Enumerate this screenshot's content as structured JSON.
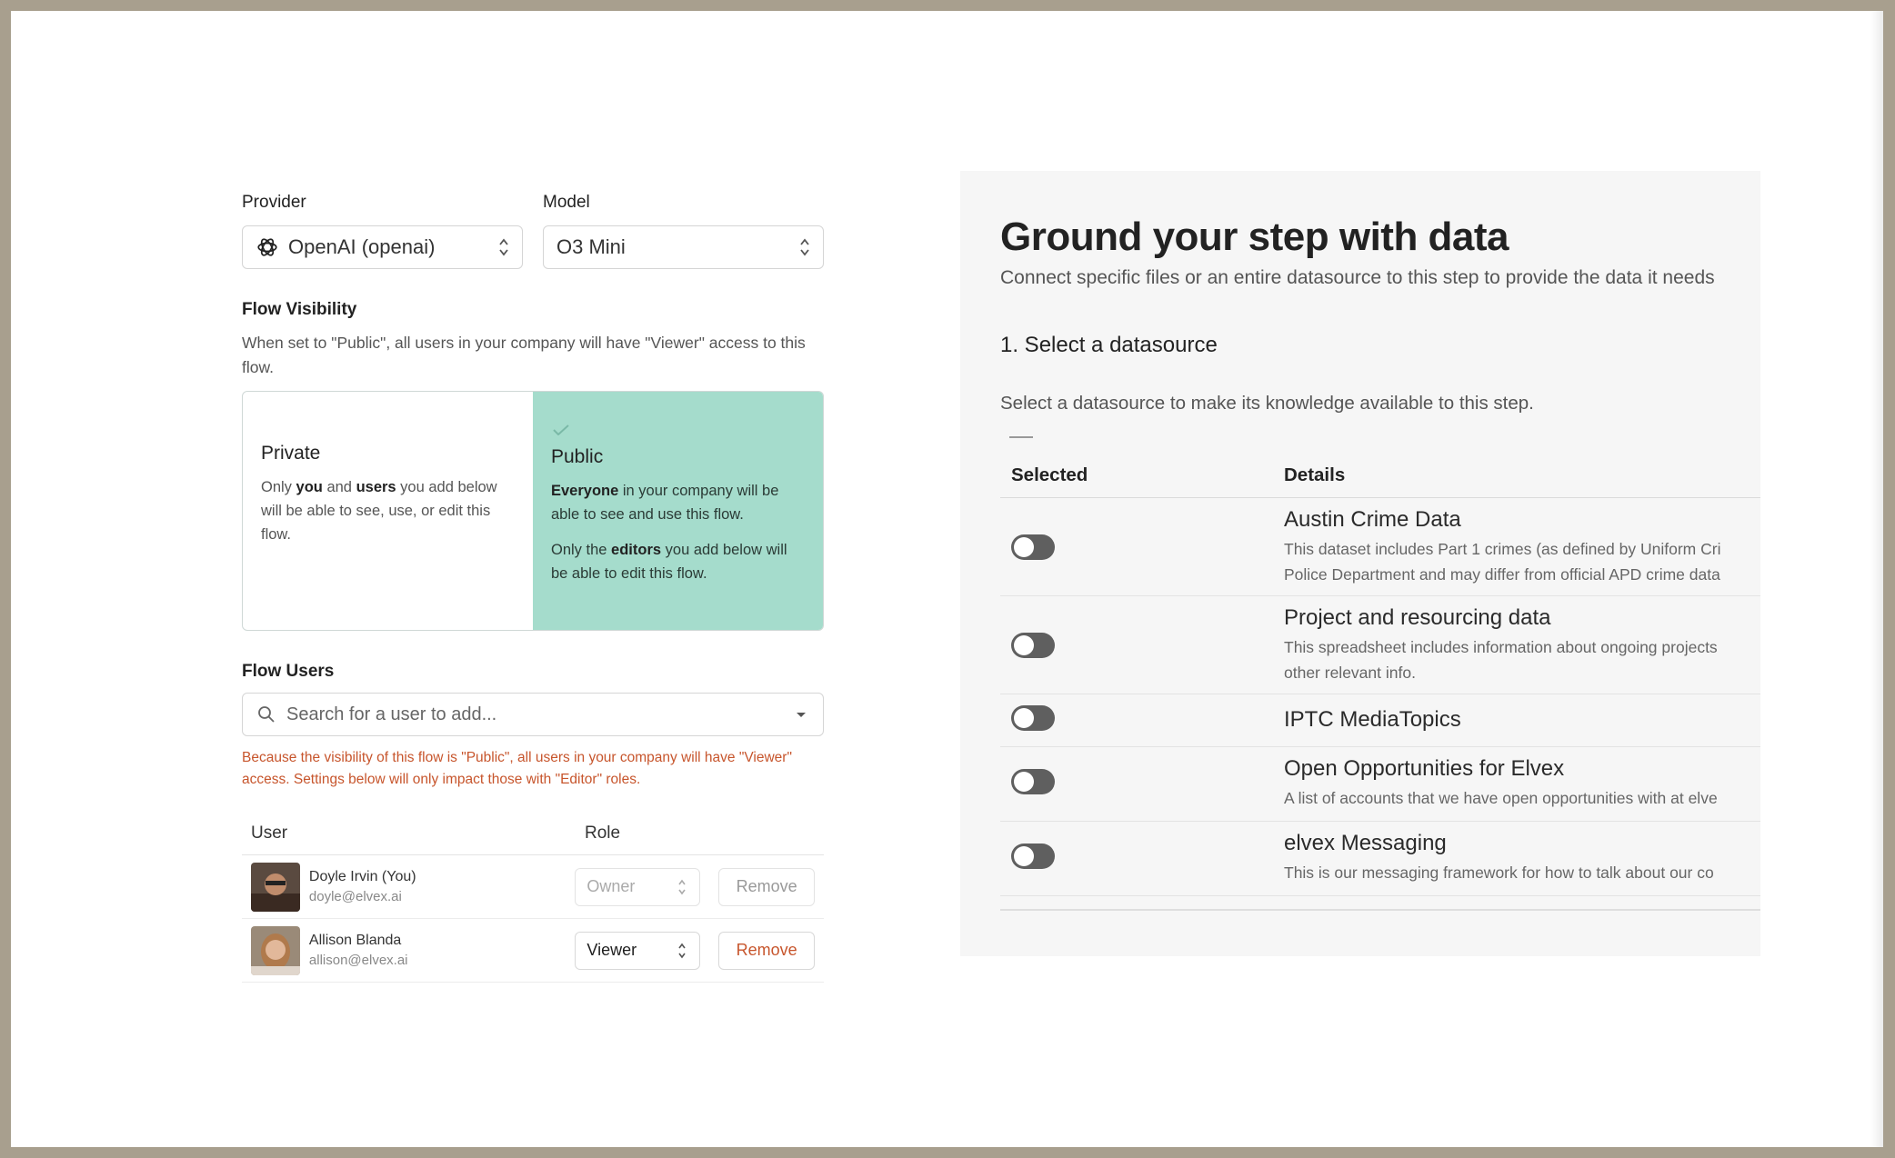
{
  "left": {
    "provider": {
      "label": "Provider",
      "value": "OpenAI (openai)"
    },
    "model": {
      "label": "Model",
      "value": "O3 Mini"
    },
    "visibility": {
      "title": "Flow Visibility",
      "description": "When set to \"Public\", all users in your company will have \"Viewer\" access to this flow.",
      "private": {
        "title": "Private",
        "t1": "Only ",
        "b1": "you",
        "t2": " and ",
        "b2": "users",
        "t3": " you add below will be able to see, use, or edit this flow."
      },
      "public": {
        "title": "Public",
        "b1": "Everyone",
        "t1": " in your company will be able to see and use this flow.",
        "t2": "Only the ",
        "b2": "editors",
        "t3": " you add below will be able to edit this flow."
      }
    },
    "users": {
      "title": "Flow Users",
      "search_placeholder": "Search for a user to add...",
      "warning": "Because the visibility of this flow is \"Public\", all users in your company will have \"Viewer\" access. Settings below will only impact those with \"Editor\" roles.",
      "columns": [
        "User",
        "Role"
      ],
      "rows": [
        {
          "name": "Doyle Irvin (You)",
          "email": "doyle@elvex.ai",
          "role": "Owner",
          "remove": "Remove"
        },
        {
          "name": "Allison Blanda",
          "email": "allison@elvex.ai",
          "role": "Viewer",
          "remove": "Remove"
        }
      ]
    }
  },
  "right": {
    "title": "Ground your step with data",
    "subtitle": "Connect specific files or an entire datasource to this step to provide the data it needs",
    "step": "1. Select a datasource",
    "step_desc": "Select a datasource to make its knowledge available to this step.",
    "columns": [
      "Selected",
      "Details"
    ],
    "rows": [
      {
        "name": "Austin Crime Data",
        "desc1": "This dataset includes Part 1 crimes (as defined by Uniform Cri",
        "desc2": "Police Department and may differ from official APD crime data",
        "on": false
      },
      {
        "name": "Project and resourcing data",
        "desc1": "This spreadsheet includes information about ongoing projects",
        "desc2": "other relevant info.",
        "on": false
      },
      {
        "name": "IPTC MediaTopics",
        "desc1": "",
        "desc2": "",
        "on": false
      },
      {
        "name": "Open Opportunities for Elvex",
        "desc1": "A list of accounts that we have open opportunities with at elve",
        "desc2": "",
        "on": false
      },
      {
        "name": "elvex Messaging",
        "desc1": "This is our messaging framework for how to talk about our co",
        "desc2": "",
        "on": false
      }
    ]
  },
  "colors": {
    "public_selected": "#a5dccc",
    "warning": "#c7552c",
    "toggle_off": "#5f5f5f",
    "frame": "#a89f8e"
  }
}
